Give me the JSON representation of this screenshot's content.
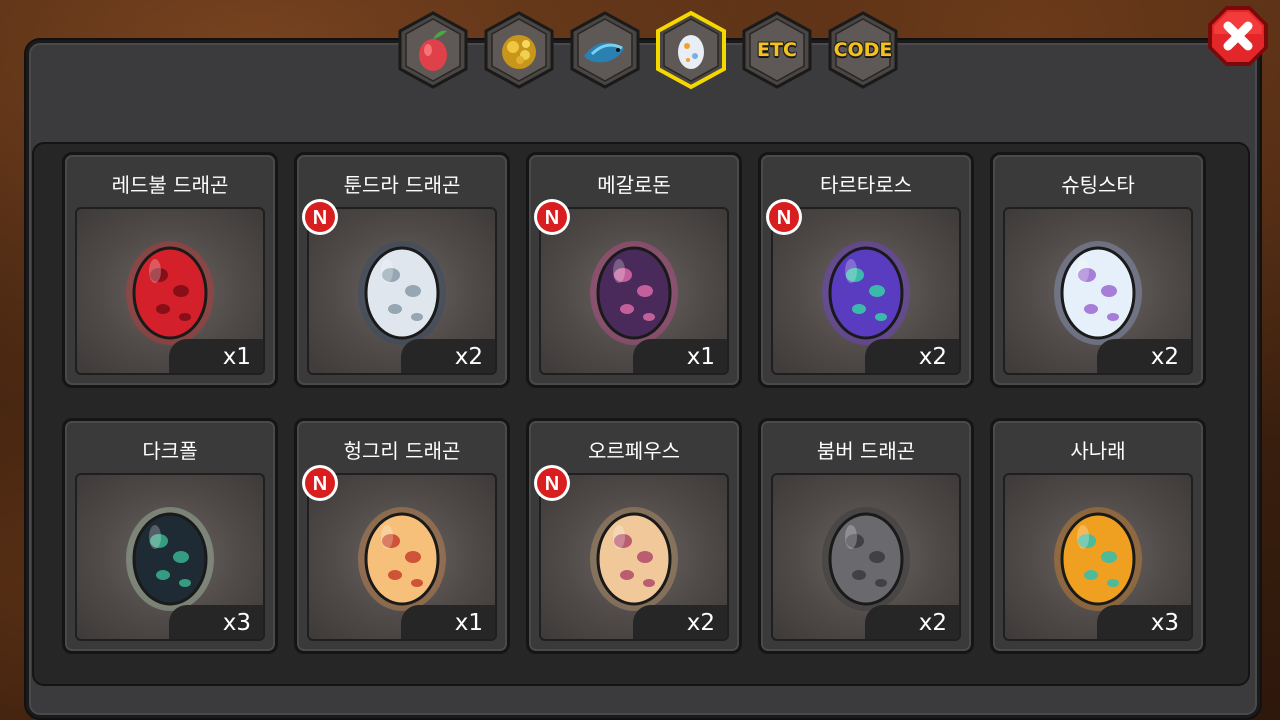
{
  "tabs": [
    {
      "id": "fruit",
      "icon": "fruit-icon",
      "label": ""
    },
    {
      "id": "gold",
      "icon": "gold-ore-icon",
      "label": ""
    },
    {
      "id": "fish",
      "icon": "fish-icon",
      "label": ""
    },
    {
      "id": "egg",
      "icon": "egg-icon",
      "label": "",
      "active": true
    },
    {
      "id": "etc",
      "icon": "",
      "label": "ETC"
    },
    {
      "id": "code",
      "icon": "",
      "label": "CODE"
    }
  ],
  "items": [
    {
      "name": "레드불 드래곤",
      "count": "x1",
      "new": false,
      "egg": {
        "base": "#d3202a",
        "spot": "#7a0d14",
        "glow": "#e03030"
      }
    },
    {
      "name": "툰드라 드래곤",
      "count": "x2",
      "new": true,
      "egg": {
        "base": "#dfe6ee",
        "spot": "#8a9aa8",
        "glow": "#2a4a70"
      }
    },
    {
      "name": "메갈로돈",
      "count": "x1",
      "new": true,
      "egg": {
        "base": "#4a2a5a",
        "spot": "#d86aa8",
        "glow": "#e04aa0"
      }
    },
    {
      "name": "타르타로스",
      "count": "x2",
      "new": true,
      "egg": {
        "base": "#5a3cc0",
        "spot": "#36d0a8",
        "glow": "#7a3cff"
      }
    },
    {
      "name": "슈팅스타",
      "count": "x2",
      "new": false,
      "egg": {
        "base": "#e6f0fa",
        "spot": "#9a6ad0",
        "glow": "#9ab0e0"
      }
    },
    {
      "name": "다크폴",
      "count": "x3",
      "new": false,
      "egg": {
        "base": "#1e2a34",
        "spot": "#3ab090",
        "glow": "#c0e0c0"
      }
    },
    {
      "name": "헝그리 드래곤",
      "count": "x1",
      "new": true,
      "egg": {
        "base": "#f6c07a",
        "spot": "#c8402a",
        "glow": "#f09a50"
      }
    },
    {
      "name": "오르페우스",
      "count": "x2",
      "new": true,
      "egg": {
        "base": "#f0c89a",
        "spot": "#b04a6a",
        "glow": "#d8a870"
      }
    },
    {
      "name": "붐버 드래곤",
      "count": "x2",
      "new": false,
      "egg": {
        "base": "#6a6a6e",
        "spot": "#3a3a3e",
        "glow": "#303030"
      }
    },
    {
      "name": "사나래",
      "count": "x3",
      "new": false,
      "egg": {
        "base": "#f0a020",
        "spot": "#30c0b0",
        "glow": "#f09020"
      }
    }
  ],
  "badge_label": "N",
  "close_icon": "close-icon"
}
